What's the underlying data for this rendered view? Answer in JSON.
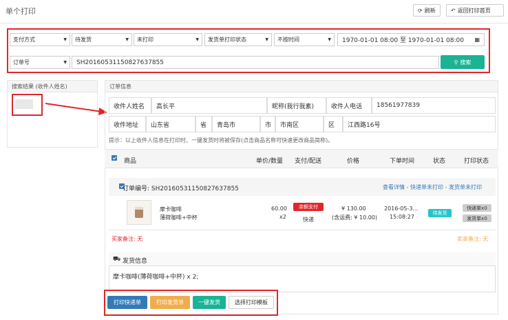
{
  "header": {
    "title": "单个打印",
    "refresh_label": "刷新",
    "back_label": "返回打印首页"
  },
  "filters": {
    "payment": "支付方式",
    "ship_status": "待发货",
    "print_status": "未打印",
    "invoice_print_status": "发货单打印状态",
    "time_type": "不按时间",
    "date_range": "1970-01-01 08:00 至 1970-01-01 08:00",
    "search_field": "订单号",
    "search_value": "SH20160531150827637855",
    "search_button": "搜索"
  },
  "search_results": {
    "heading": "搜索结果 (收件人姓名)"
  },
  "order_info": {
    "heading": "订单信息",
    "recipient_label": "收件人姓名",
    "recipient_value": "高长平",
    "nickname_label": "昵称(我行我素)",
    "phone_label": "收件人电话",
    "phone_value": "18561977839",
    "address_label": "收件地址",
    "province": "山东省",
    "province_label": "省",
    "city": "青岛市",
    "city_label": "市",
    "district": "市南区",
    "district_label": "区",
    "street": "江西路16号",
    "tip": "提示：以上收件人信息在打印时、一键发货时将被保存(点击商品名称可快速更改商品简称)。"
  },
  "table": {
    "headers": [
      "商品",
      "单价/数量",
      "支付/配送",
      "价格",
      "下单时间",
      "状态",
      "打印状态"
    ],
    "order_no_label": "订单编号: SH20160531150827637855",
    "links": "查看详情 - 快递单未打印 - 发货单未打印",
    "product_name": "摩卡咖啡",
    "product_spec": "薄荷咖啡+中杯",
    "unit_price": "60.00",
    "quantity": "x2",
    "pay_badge": "余额支付",
    "delivery": "快递",
    "price": "¥ 130.00",
    "shipping": "(含运费: ¥ 10.00)",
    "order_date": "2016-05-3...",
    "order_time": "15:08:27",
    "status_badge": "待发货",
    "print_express": "快递单x0",
    "print_invoice": "发货单x0",
    "buyer_note": "买家备注: 无",
    "seller_note": "卖家备注: 无"
  },
  "ship_info": {
    "heading": "发货信息",
    "content": "摩卡咖啡(薄荷咖啡+中杯) x 2;"
  },
  "actions": {
    "print_express": "打印快递单",
    "print_invoice": "打印发货单",
    "one_click_ship": "一键发货",
    "choose_template": "选择打印模板"
  }
}
